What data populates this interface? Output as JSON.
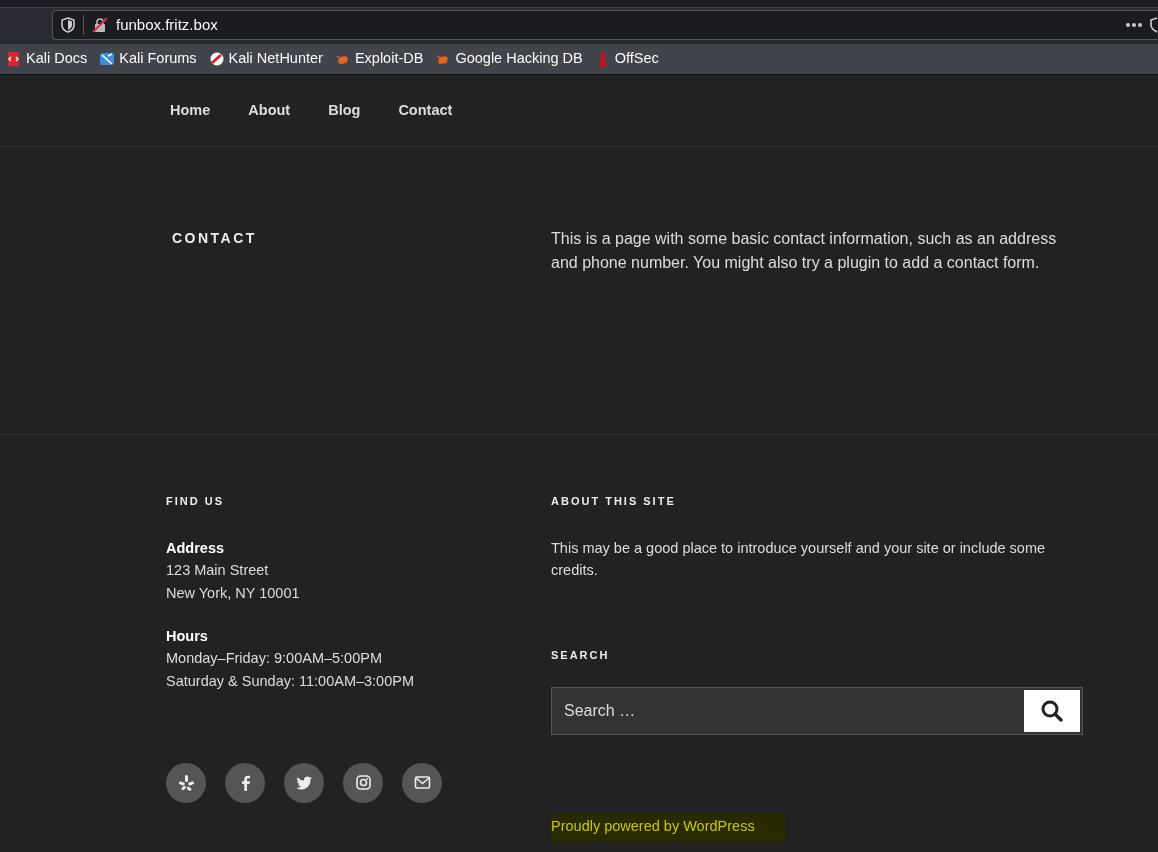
{
  "browser": {
    "url": "funbox.fritz.box",
    "bookmarks": [
      {
        "label": "Kali Docs",
        "kind": "docs"
      },
      {
        "label": "Kali Forums",
        "kind": "forums"
      },
      {
        "label": "Kali NetHunter",
        "kind": "nethunter"
      },
      {
        "label": "Exploit-DB",
        "kind": "bug"
      },
      {
        "label": "Google Hacking DB",
        "kind": "bug"
      },
      {
        "label": "OffSec",
        "kind": "offsec"
      }
    ]
  },
  "nav": {
    "items": [
      "Home",
      "About",
      "Blog",
      "Contact"
    ]
  },
  "page": {
    "title": "CONTACT",
    "body": "This is a page with some basic contact information, such as an address and phone number. You might also try a plugin to add a contact form."
  },
  "footer": {
    "find_us": {
      "heading": "FIND US",
      "blocks": [
        {
          "title": "Address",
          "lines": [
            "123 Main Street",
            "New York, NY 10001"
          ]
        },
        {
          "title": "Hours",
          "lines": [
            "Monday–Friday: 9:00AM–5:00PM",
            "Saturday & Sunday: 11:00AM–3:00PM"
          ]
        }
      ]
    },
    "about": {
      "heading": "ABOUT THIS SITE",
      "text": "This may be a good place to introduce yourself and your site or include some credits."
    },
    "search": {
      "heading": "SEARCH",
      "placeholder": "Search …"
    },
    "social": [
      {
        "kind": "burst"
      },
      {
        "kind": "f"
      },
      {
        "kind": "bird"
      },
      {
        "kind": "camera"
      },
      {
        "kind": "mail"
      }
    ],
    "credit": "Proudly powered by WordPress"
  }
}
